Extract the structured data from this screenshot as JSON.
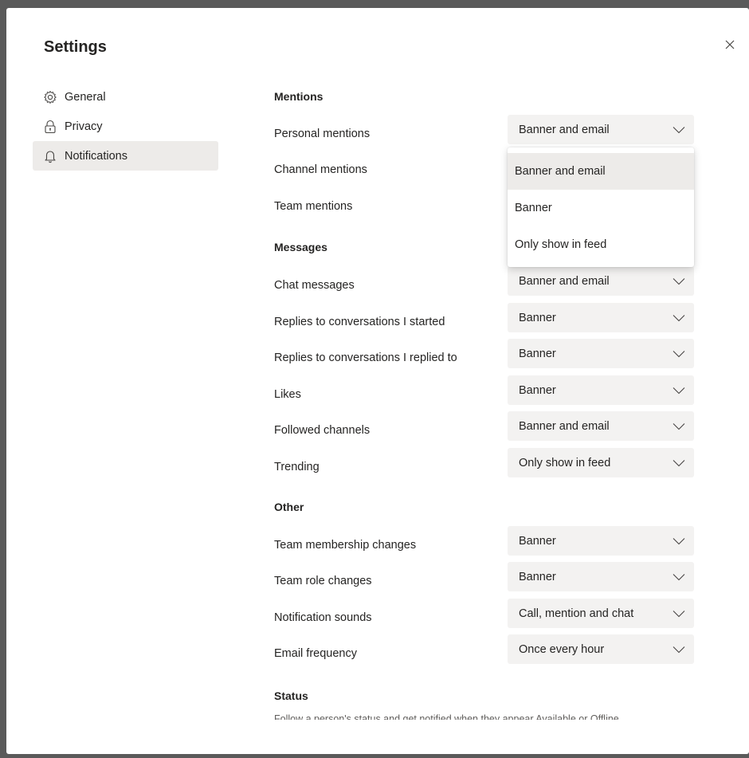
{
  "title": "Settings",
  "nav": {
    "items": [
      {
        "label": "General",
        "icon": "gear-icon"
      },
      {
        "label": "Privacy",
        "icon": "lock-icon"
      },
      {
        "label": "Notifications",
        "icon": "bell-icon",
        "active": true
      }
    ]
  },
  "sections": {
    "mentions": "Mentions",
    "messages": "Messages",
    "other": "Other",
    "status": "Status"
  },
  "rows": {
    "personal_mentions": {
      "label": "Personal mentions",
      "value": "Banner and email"
    },
    "channel_mentions": {
      "label": "Channel mentions"
    },
    "team_mentions": {
      "label": "Team mentions"
    },
    "chat_messages": {
      "label": "Chat messages",
      "value": "Banner and email"
    },
    "replies_started": {
      "label": "Replies to conversations I started",
      "value": "Banner"
    },
    "replies_replied": {
      "label": "Replies to conversations I replied to",
      "value": "Banner"
    },
    "likes": {
      "label": "Likes",
      "value": "Banner"
    },
    "followed_channels": {
      "label": "Followed channels",
      "value": "Banner and email"
    },
    "trending": {
      "label": "Trending",
      "value": "Only show in feed"
    },
    "team_membership": {
      "label": "Team membership changes",
      "value": "Banner"
    },
    "team_role": {
      "label": "Team role changes",
      "value": "Banner"
    },
    "notification_sounds": {
      "label": "Notification sounds",
      "value": "Call, mention and chat"
    },
    "email_frequency": {
      "label": "Email frequency",
      "value": "Once every hour"
    }
  },
  "dropdown": {
    "options": [
      "Banner and email",
      "Banner",
      "Only show in feed"
    ],
    "selected": "Banner and email"
  },
  "status_description": "Follow a person's status and get notified when they appear Available or Offline.",
  "colors": {
    "selected_bg": "#edebe9",
    "field_bg": "#f3f2f1",
    "text": "#252423"
  }
}
